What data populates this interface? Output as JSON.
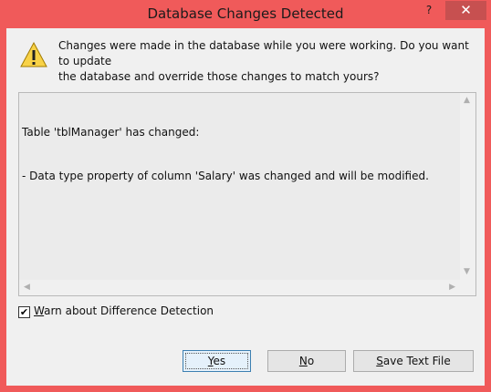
{
  "window": {
    "title": "Database Changes Detected",
    "help_glyph": "?",
    "close_glyph": "✕"
  },
  "dialog": {
    "message_line1": "Changes were made in the database while you were working. Do you want to update",
    "message_line2": "the database and override those changes to match yours?",
    "details_line1": "Table 'tblManager' has changed:",
    "details_line2": "- Data type property of column 'Salary' was changed and will be modified.",
    "checkbox_label_underlined": "W",
    "checkbox_label_rest": "arn about Difference Detection",
    "checkbox_checked": true
  },
  "buttons": {
    "yes_u": "Y",
    "yes_rest": "es",
    "no_u": "N",
    "no_rest": "o",
    "save_u": "S",
    "save_rest": "ave Text File"
  },
  "colors": {
    "window_frame": "#f05a5a",
    "close_button": "#c75050",
    "dialog_bg": "#f0f0f0"
  },
  "icons": [
    "warning-icon",
    "help-icon",
    "close-icon",
    "checkmark-icon"
  ]
}
